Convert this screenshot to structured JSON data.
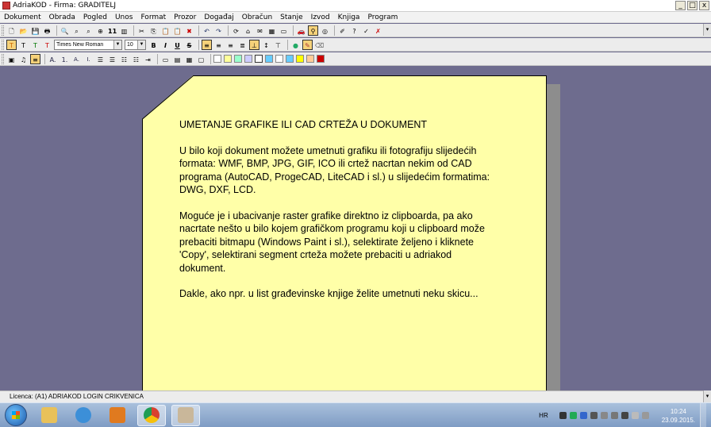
{
  "window": {
    "title": "AdriaKOD - Firma: GRADITELJ",
    "min_label": "_",
    "max_label": "□",
    "close_label": "x"
  },
  "menu": [
    "Dokument",
    "Obrada",
    "Pogled",
    "Unos",
    "Format",
    "Prozor",
    "Događaj",
    "Obračun",
    "Stanje",
    "Izvod",
    "Knjiga",
    "Program"
  ],
  "toolbar1": {
    "icons": [
      "new-doc-icon",
      "open-folder-icon",
      "save-icon",
      "print-icon",
      "preview-icon",
      "find-icon",
      "find-next-icon",
      "zoom-icon",
      "page-number-icon",
      "columns-icon",
      "cut-icon",
      "copy-icon",
      "paste-icon",
      "paste-special-icon",
      "delete-icon",
      "undo-icon",
      "redo-icon",
      "refresh-icon",
      "home-icon",
      "envelope-icon",
      "calendar-icon",
      "window-icon",
      "car-icon",
      "binoculars-icon",
      "help-ring-icon",
      "brush-icon",
      "tip-icon",
      "check-icon",
      "close-red-icon"
    ],
    "page_number_label": "11"
  },
  "toolbar2": {
    "style_buttons": [
      "T",
      "T",
      "T",
      "T"
    ],
    "font_name": "Times New Roman",
    "font_size": "10",
    "bold": "B",
    "italic": "I",
    "underline": "U",
    "strike": "S",
    "style_colors": [
      "#cc6600",
      "#000000",
      "#007700",
      "#cc0000"
    ]
  },
  "toolbar3": {
    "list_labels": [
      "A.",
      "1.",
      "A.",
      "I."
    ],
    "swatches": [
      "#ffffff",
      "#ffff99",
      "#99ffcc",
      "#ccccff",
      "#ffffff",
      "#66ccff",
      "#ffffff",
      "#66ccff",
      "#ffff00",
      "#ffcc99",
      "#cc0000"
    ]
  },
  "note": {
    "heading": "UMETANJE GRAFIKE ILI CAD CRTEŽA U DOKUMENT",
    "paragraphs": [
      "U bilo koji dokument možete umetnuti grafiku ili fotografiju slijedećih\nformata: WMF, BMP, JPG, GIF, ICO ili crtež nacrtan nekim od CAD\nprograma (AutoCAD, ProgeCAD, LiteCAD i sl.) u slijedećim formatima:\nDWG, DXF, LCD.",
      "Moguće je i ubacivanje raster grafike direktno iz clipboarda, pa ako\nnacrtate nešto u bilo kojem grafičkom programu koji u clipboard može\nprebaciti bitmapu (Windows Paint i sl.), selektirate željeno i kliknete\n'Copy', selektirani segment crteža možete prebaciti u adriakod\ndokument.",
      "Dakle, ako npr. u list građevinske knjige želite umetnuti neku skicu..."
    ]
  },
  "status": {
    "license": "Licenca: (A1) ADRIAKOD LOGIN CRIKVENICA"
  },
  "taskbar": {
    "apps": [
      {
        "name": "explorer-taskbar-icon",
        "color": "#e8c15a",
        "active": false
      },
      {
        "name": "ie-taskbar-icon",
        "color": "#3c8fd8",
        "active": false
      },
      {
        "name": "media-player-taskbar-icon",
        "color": "#e07a1f",
        "active": false
      },
      {
        "name": "chrome-taskbar-icon",
        "color": "#d9412f",
        "active": true
      },
      {
        "name": "adriakod-taskbar-icon",
        "color": "#c9b79a",
        "active": true
      }
    ],
    "language": "HR",
    "time": "10:24",
    "date": "23.09.2015."
  }
}
